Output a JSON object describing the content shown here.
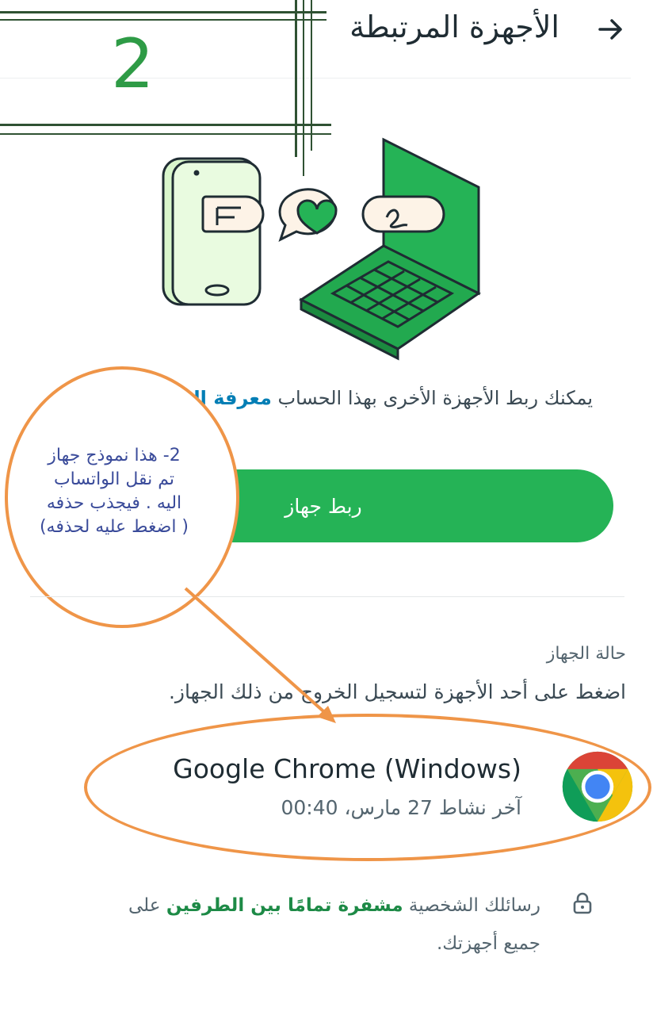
{
  "header": {
    "title": "الأجهزة المرتبطة",
    "back_icon": "arrow-right-icon"
  },
  "annotation_box": {
    "number": "2"
  },
  "illustration": {
    "icon": "linked-devices-illustration"
  },
  "description": {
    "text": "يمكنك ربط الأجهزة الأخرى بهذا الحساب",
    "learn_more": "معرفة المزيد"
  },
  "link_button": {
    "label": "ربط جهاز"
  },
  "circle_annotation": {
    "line1": "2- هذا نموذج جهاز",
    "line2": "تم نقل الواتساب",
    "line3": "اليه . فيجذب حذفه",
    "line4": "( اضغط عليه لحذفه)"
  },
  "device_status": {
    "label": "حالة الجهاز",
    "instruction": "اضغط على أحد الأجهزة لتسجيل الخروج من ذلك الجهاز."
  },
  "device": {
    "name": "Google Chrome (Windows)",
    "last_active": "آخر نشاط 27 مارس، 00:40",
    "icon": "chrome-icon"
  },
  "footer": {
    "prefix": "رسائلك الشخصية",
    "encrypted": "مشفرة تمامًا بين الطرفين",
    "suffix": "على جميع أجهزتك."
  },
  "colors": {
    "accent_green": "#25b356",
    "annotation_orange": "#ef9548",
    "link_blue": "#027eb5"
  }
}
